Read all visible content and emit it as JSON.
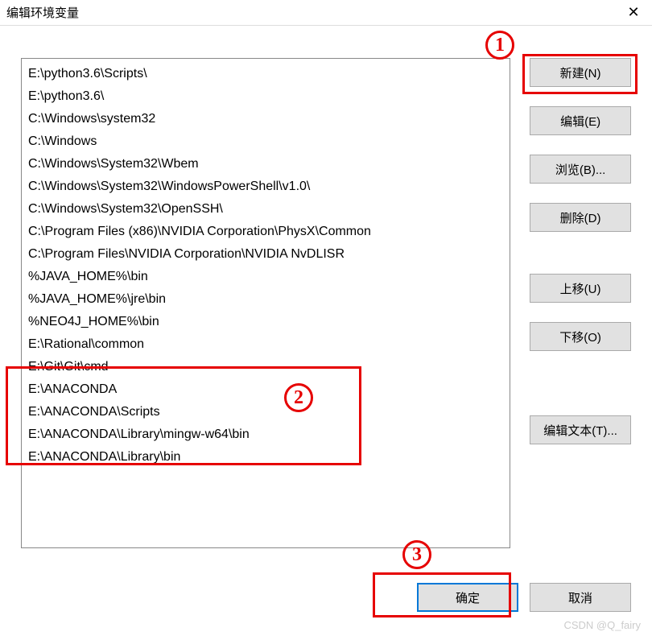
{
  "window": {
    "title": "编辑环境变量",
    "close_glyph": "✕"
  },
  "list": {
    "items": [
      "E:\\python3.6\\Scripts\\",
      "E:\\python3.6\\",
      "C:\\Windows\\system32",
      "C:\\Windows",
      "C:\\Windows\\System32\\Wbem",
      "C:\\Windows\\System32\\WindowsPowerShell\\v1.0\\",
      "C:\\Windows\\System32\\OpenSSH\\",
      "C:\\Program Files (x86)\\NVIDIA Corporation\\PhysX\\Common",
      "C:\\Program Files\\NVIDIA Corporation\\NVIDIA NvDLISR",
      "%JAVA_HOME%\\bin",
      "%JAVA_HOME%\\jre\\bin",
      "%NEO4J_HOME%\\bin",
      "E:\\Rational\\common",
      "E:\\Git\\Git\\cmd",
      "E:\\ANACONDA",
      "E:\\ANACONDA\\Scripts",
      "E:\\ANACONDA\\Library\\mingw-w64\\bin",
      "E:\\ANACONDA\\Library\\bin"
    ]
  },
  "buttons": {
    "new": "新建(N)",
    "edit": "编辑(E)",
    "browse": "浏览(B)...",
    "delete": "删除(D)",
    "move_up": "上移(U)",
    "move_down": "下移(O)",
    "edit_text": "编辑文本(T)..."
  },
  "footer": {
    "ok": "确定",
    "cancel": "取消"
  },
  "annotations": {
    "n1": "1",
    "n2": "2",
    "n3": "3"
  },
  "watermark": "CSDN @Q_fairy"
}
